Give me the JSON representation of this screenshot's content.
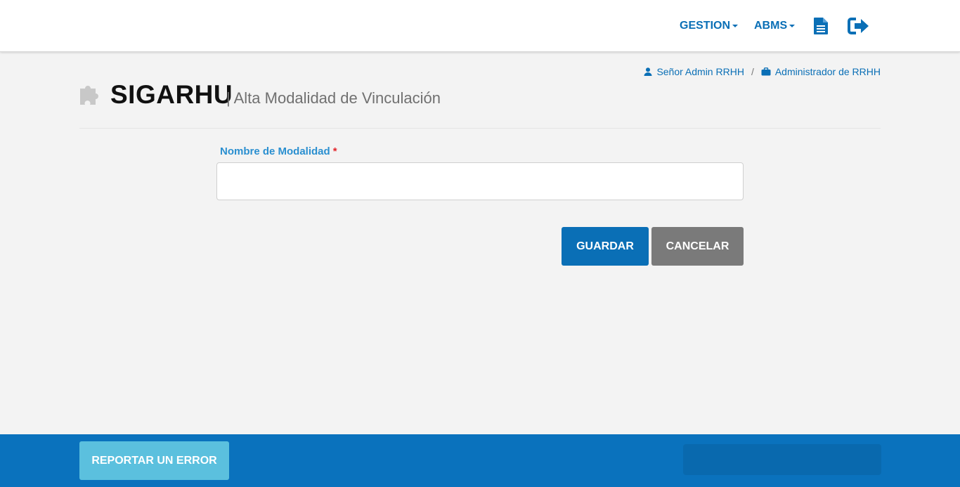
{
  "nav": {
    "gestion_label": "GESTION",
    "abms_label": "ABMS",
    "doc_icon": "document-icon",
    "exit_icon": "sign-out-icon"
  },
  "user": {
    "name": "Señor Admin RRHH",
    "separator": "/",
    "role": "Administrador de RRHH"
  },
  "header": {
    "app_name": "SIGARHU",
    "subtitle": "| Alta Modalidad de Vinculación"
  },
  "form": {
    "field_label": "Nombre de Modalidad",
    "required_mark": "*",
    "field_value": "",
    "save_label": "GUARDAR",
    "cancel_label": "CANCELAR"
  },
  "footer": {
    "report_label": "REPORTAR UN ERROR"
  },
  "colors": {
    "primary": "#0a6fb6",
    "label": "#2a8fd0",
    "required": "#e3262c",
    "cancel": "#7a7a7a",
    "report": "#5bc0de",
    "footer": "#0a72bd"
  }
}
